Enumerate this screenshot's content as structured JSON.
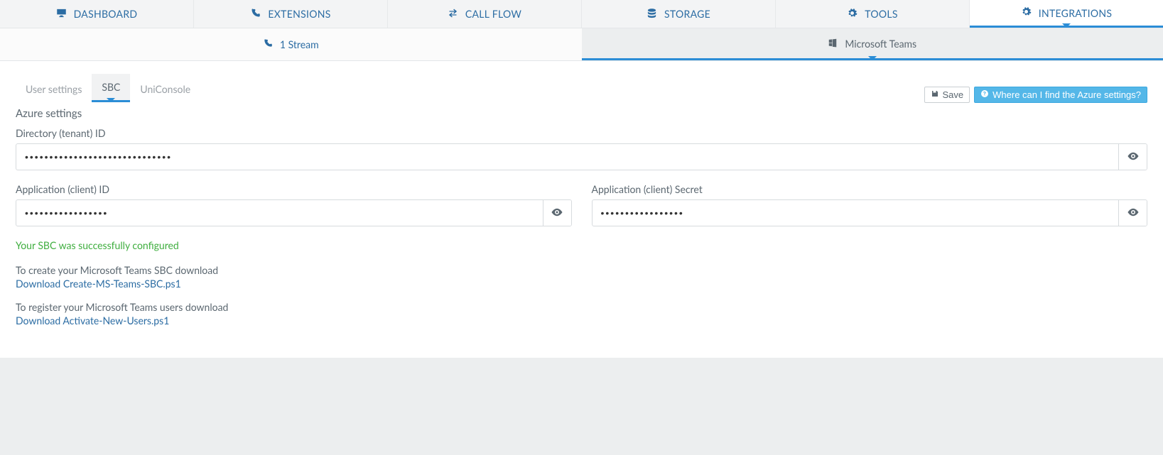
{
  "topnav": [
    {
      "label": "DASHBOARD",
      "icon": "monitor"
    },
    {
      "label": "EXTENSIONS",
      "icon": "phone"
    },
    {
      "label": "CALL FLOW",
      "icon": "exchange"
    },
    {
      "label": "STORAGE",
      "icon": "database"
    },
    {
      "label": "TOOLS",
      "icon": "gears"
    },
    {
      "label": "INTEGRATIONS",
      "icon": "gears"
    }
  ],
  "subnav": [
    {
      "label": "1 Stream",
      "icon": "phone"
    },
    {
      "label": "Microsoft Teams",
      "icon": "windows"
    }
  ],
  "inner_tabs": {
    "user_settings": "User settings",
    "sbc": "SBC",
    "uniconsole": "UniConsole"
  },
  "actions": {
    "save": "Save",
    "help": "Where can I find the Azure settings?"
  },
  "section": {
    "title": "Azure settings",
    "tenant_label": "Directory (tenant) ID",
    "tenant_value": "••••••••••••••••••••••••••••••",
    "client_id_label": "Application (client) ID",
    "client_id_value": "•••••••••••••••••",
    "client_secret_label": "Application (client) Secret",
    "client_secret_value": "•••••••••••••••••"
  },
  "messages": {
    "success": "Your SBC was successfully configured",
    "sbc_text": "To create your Microsoft Teams SBC download",
    "sbc_link": "Download Create-MS-Teams-SBC.ps1",
    "users_text": "To register your Microsoft Teams users download",
    "users_link": "Download Activate-New-Users.ps1"
  }
}
